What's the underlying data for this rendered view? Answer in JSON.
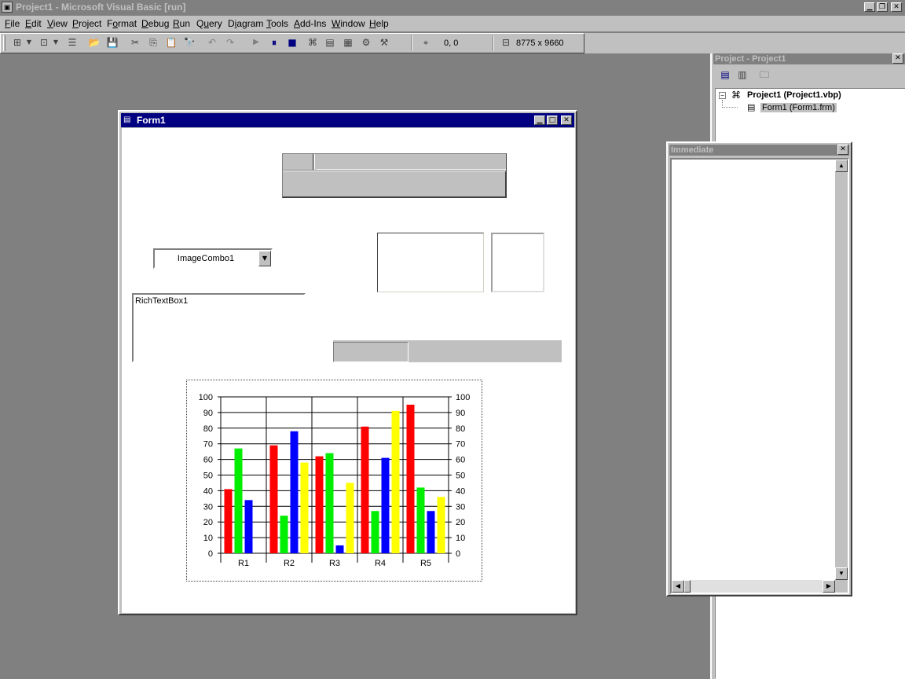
{
  "app": {
    "title": "Project1 - Microsoft Visual Basic [run]"
  },
  "menu": [
    {
      "key": "F",
      "rest": "ile"
    },
    {
      "key": "E",
      "rest": "dit"
    },
    {
      "key": "V",
      "rest": "iew"
    },
    {
      "key": "P",
      "rest": "roject"
    },
    {
      "pre": "F",
      "key": "o",
      "rest": "rmat"
    },
    {
      "key": "D",
      "rest": "ebug"
    },
    {
      "key": "R",
      "rest": "un"
    },
    {
      "pre": "Q",
      "key": "u",
      "rest": "ery"
    },
    {
      "pre": "D",
      "key": "i",
      "rest": "agram"
    },
    {
      "key": "T",
      "rest": "ools"
    },
    {
      "key": "A",
      "rest": "dd-Ins"
    },
    {
      "key": "W",
      "rest": "indow"
    },
    {
      "key": "H",
      "rest": "elp"
    }
  ],
  "toolbar": {
    "position": "0, 0",
    "size": "8775 x 9660"
  },
  "project_explorer": {
    "title": "Project - Project1",
    "project_node": "Project1 (Project1.vbp)",
    "form_node": "Form1 (Form1.frm)"
  },
  "immediate": {
    "title": "Immediate"
  },
  "form": {
    "title": "Form1",
    "image_combo": "ImageCombo1",
    "rich_text_box": "RichTextBox1"
  },
  "chart_data": {
    "type": "bar",
    "categories": [
      "R1",
      "R2",
      "R3",
      "R4",
      "R5"
    ],
    "series": [
      {
        "color": "#ff0000",
        "values": [
          41,
          69,
          62,
          81,
          95
        ]
      },
      {
        "color": "#00ee00",
        "values": [
          67,
          24,
          64,
          27,
          42
        ]
      },
      {
        "color": "#0000ff",
        "values": [
          34,
          78,
          5,
          61,
          27
        ]
      },
      {
        "color": "#ffff00",
        "values": [
          0,
          58,
          45,
          91,
          36
        ]
      }
    ],
    "ylim": [
      0,
      100
    ],
    "yticks": [
      0,
      10,
      20,
      30,
      40,
      50,
      60,
      70,
      80,
      90,
      100
    ],
    "grid": true,
    "secondary_axis": true
  }
}
